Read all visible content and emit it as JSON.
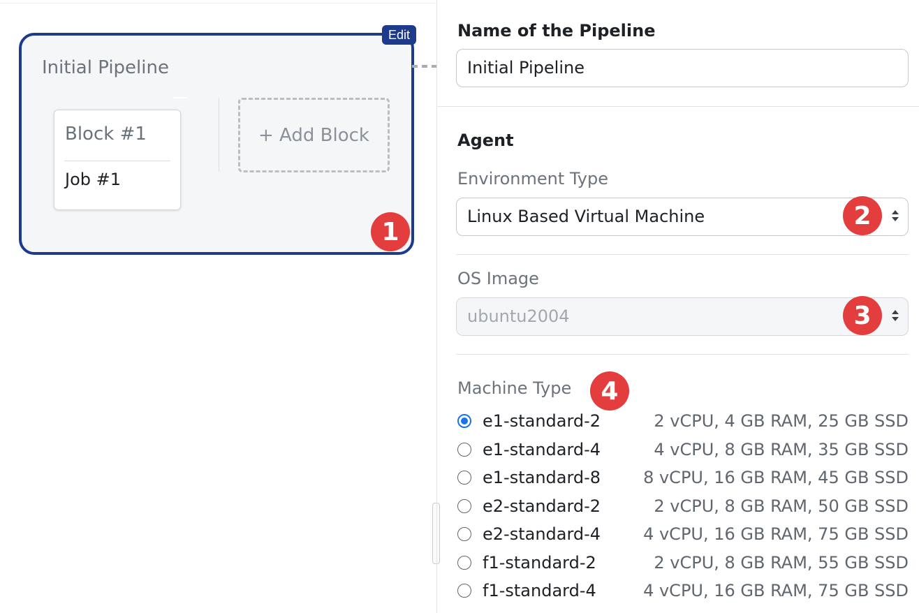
{
  "canvas": {
    "pipeline": {
      "edit_label": "Edit",
      "title": "Initial Pipeline",
      "block_title": "Block #1",
      "job_title": "Job #1",
      "add_block_label": "+ Add Block"
    },
    "badges": [
      "1",
      "2",
      "3",
      "4"
    ]
  },
  "panel": {
    "name_label": "Name of the Pipeline",
    "name_value": "Initial Pipeline",
    "agent_heading": "Agent",
    "env_label": "Environment Type",
    "env_value": "Linux Based Virtual Machine",
    "os_label": "OS Image",
    "os_value": "ubuntu2004",
    "machine_label": "Machine Type",
    "machines": [
      {
        "name": "e1-standard-2",
        "spec": "2 vCPU, 4 GB RAM, 25 GB SSD",
        "selected": true
      },
      {
        "name": "e1-standard-4",
        "spec": "4 vCPU, 8 GB RAM, 35 GB SSD",
        "selected": false
      },
      {
        "name": "e1-standard-8",
        "spec": "8 vCPU, 16 GB RAM, 45 GB SSD",
        "selected": false
      },
      {
        "name": "e2-standard-2",
        "spec": "2 vCPU, 8 GB RAM, 50 GB SSD",
        "selected": false
      },
      {
        "name": "e2-standard-4",
        "spec": "4 vCPU, 16 GB RAM, 75 GB SSD",
        "selected": false
      },
      {
        "name": "f1-standard-2",
        "spec": "2 vCPU, 8 GB RAM, 55 GB SSD",
        "selected": false
      },
      {
        "name": "f1-standard-4",
        "spec": "4 vCPU, 16 GB RAM, 75 GB SSD",
        "selected": false
      }
    ]
  },
  "colors": {
    "accent": "#1e3a8a",
    "badge": "#e33d3d",
    "radio_selected": "#1a73e8"
  }
}
